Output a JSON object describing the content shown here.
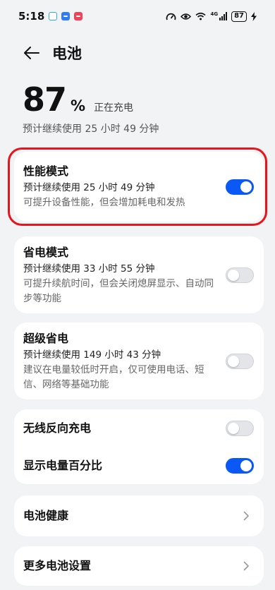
{
  "status_bar": {
    "time": "5:18",
    "battery_level": "87",
    "network_type": "4G",
    "icons": [
      "cloud-app-icon",
      "chat-notification-icon",
      "red-notification-icon",
      "speedometer-icon",
      "eye-icon",
      "wifi-icon",
      "cellular-signal-icon",
      "battery-icon",
      "charging-bolt-icon"
    ]
  },
  "header": {
    "title": "电池",
    "back_icon": "arrow-left-icon"
  },
  "battery": {
    "level": "87",
    "percent_sign": "%",
    "charging_status": "正在充电",
    "estimated_remaining": "预计继续使用 25 小时 49 分钟"
  },
  "modes": {
    "performance": {
      "title": "性能模式",
      "remaining": "预计继续使用 25 小时 49 分钟",
      "description": "可提升设备性能，但会增加耗电和发热",
      "enabled": true
    },
    "power_saving": {
      "title": "省电模式",
      "remaining": "预计继续使用 33 小时 55 分钟",
      "description": "可提升续航时间，但会关闭熄屏显示、自动同步等功能",
      "enabled": false
    },
    "super_power_saving": {
      "title": "超级省电",
      "remaining": "预计继续使用 149 小时 43 分钟",
      "description": "建议在电量较低时开启，仅可使用电话、短信、网络等基础功能",
      "enabled": false
    }
  },
  "options": {
    "reverse_wireless": {
      "label": "无线反向充电",
      "enabled": false
    },
    "show_percentage": {
      "label": "显示电量百分比",
      "enabled": true
    }
  },
  "links": {
    "battery_health": "电池健康",
    "more_settings": "更多电池设置"
  },
  "colors": {
    "accent": "#0a59f7",
    "highlight_border": "#e8141c",
    "background": "#f1f3f5",
    "card": "#ffffff"
  }
}
